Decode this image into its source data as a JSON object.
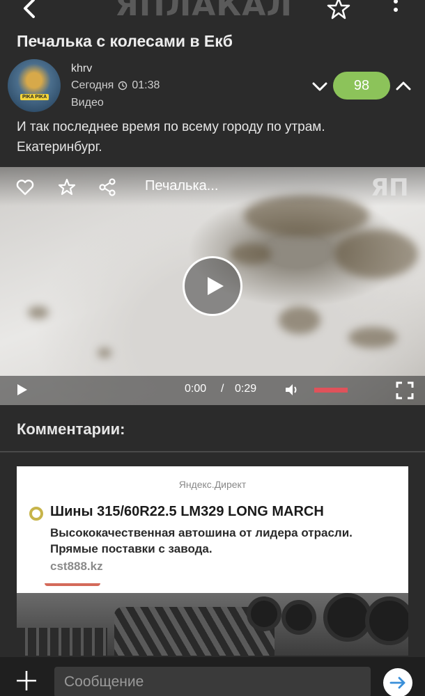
{
  "header": {
    "logo_text": "ЯПЛАКАЛ",
    "back_icon": "chevron-left-icon",
    "favorite_icon": "star-icon",
    "more_icon": "more-vertical-icon"
  },
  "post": {
    "title": "Печалька с колесами в Екб",
    "author": "khrv",
    "date": "Сегодня",
    "time": "01:38",
    "type": "Видео",
    "rating": "98",
    "text": "И так последнее время по всему городу по утрам. Екатеринбург."
  },
  "avatar": {
    "tag": "PIKA PIKA"
  },
  "video": {
    "title": "Печалька...",
    "watermark": "ЯП",
    "current_time": "0:00",
    "separator": "/",
    "duration": "0:29",
    "volume_level": 0.5
  },
  "comments": {
    "title": "Комментарии:"
  },
  "ad": {
    "source": "Яндекс.Директ",
    "title": "Шины 315/60R22.5 LM329 LONG MARCH",
    "description": "Высококачественная автошина от лидера отрасли. Прямые поставки с завода.",
    "domain": "cst888.kz"
  },
  "composer": {
    "placeholder": "Сообщение"
  },
  "colors": {
    "background": "#2b2b2b",
    "rating_bg": "#8cc35a",
    "volume_bar": "#e0525a"
  }
}
